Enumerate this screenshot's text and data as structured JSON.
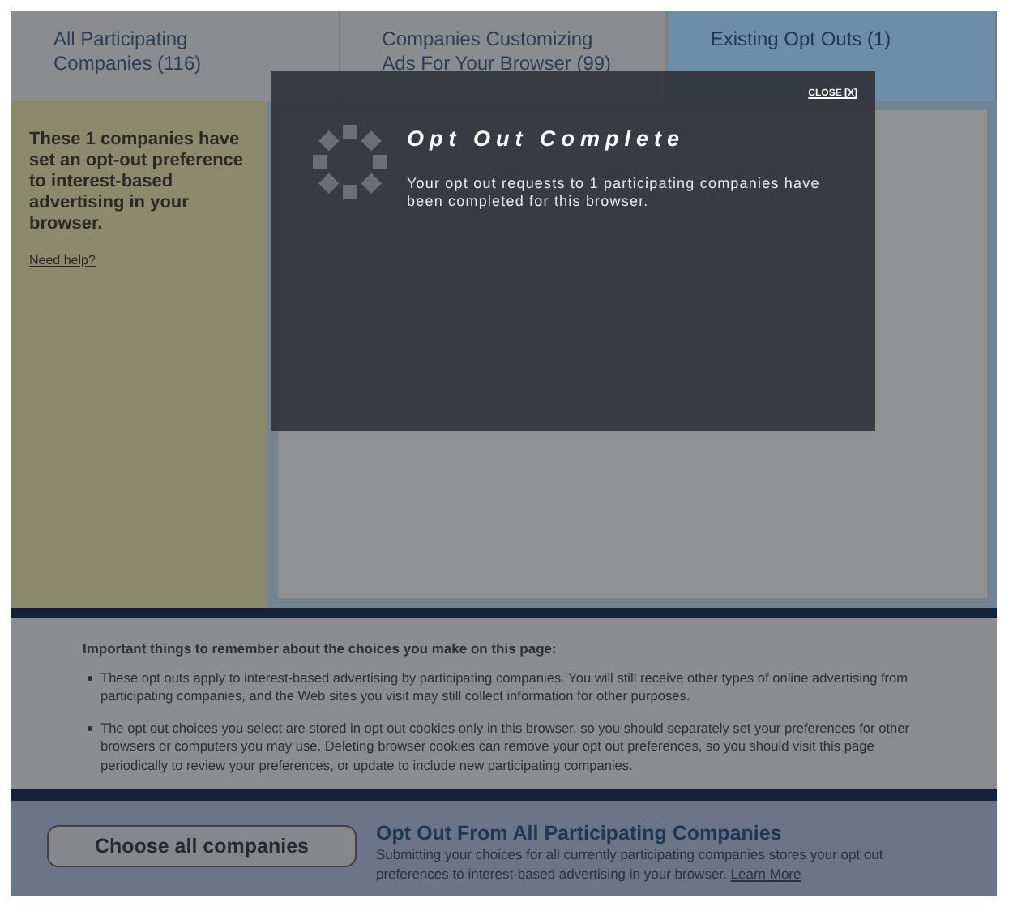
{
  "tabs": [
    {
      "label": "All Participating Companies (116)",
      "selected": false
    },
    {
      "label": "Companies Customizing Ads For Your Browser (99)",
      "selected": false
    },
    {
      "label": "Existing Opt Outs (1)",
      "selected": true
    }
  ],
  "sidebar": {
    "text": "These 1 companies have set an opt-out preference to interest-based advertising in your browser.",
    "help_link": "Need help?"
  },
  "notes": {
    "heading": "Important things to remember about the choices you make on this page:",
    "items": [
      "These opt outs apply to interest-based advertising by participating companies. You will still receive other types of online advertising from participating companies, and the Web sites you visit may still collect information for other purposes.",
      "The opt out choices you select are stored in opt out cookies only in this browser, so you should separately set your preferences for other browsers or computers you may use. Deleting browser cookies can remove your opt out preferences, so you should visit this page periodically to review your preferences, or update to include new participating companies."
    ]
  },
  "footer": {
    "button": "Choose all companies",
    "title": "Opt Out From All Participating Companies",
    "text": "Submitting your choices for all currently participating companies stores your opt out preferences to interest-based advertising in your browser.",
    "link": "Learn More"
  },
  "modal": {
    "close": "CLOSE [X]",
    "title": "Opt Out Complete",
    "message": "Your opt out requests to 1 participating companies have been completed for this browser."
  }
}
